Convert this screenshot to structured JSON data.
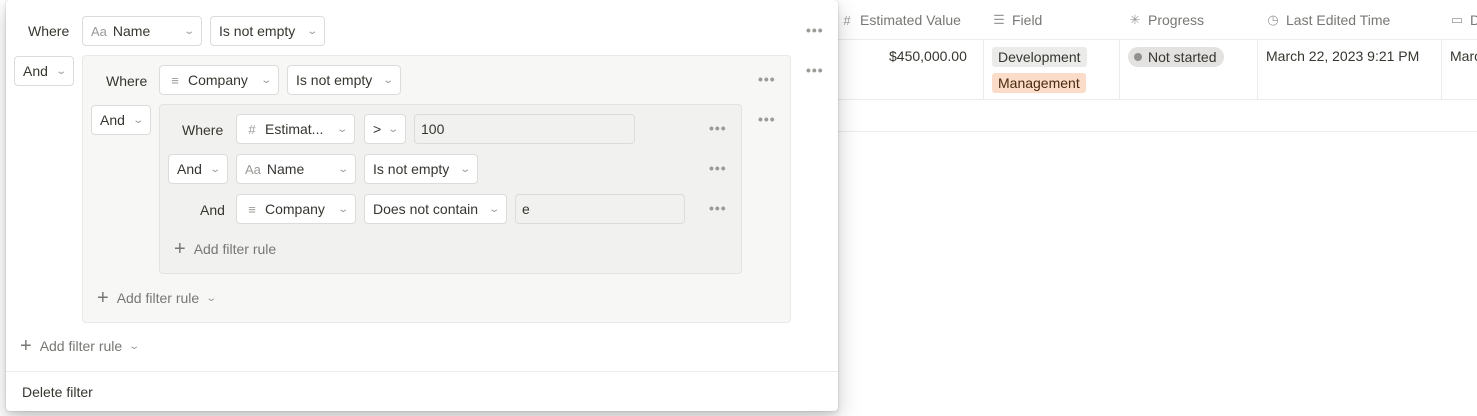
{
  "table": {
    "columns": [
      {
        "icon": "#",
        "icon_name": "number-icon",
        "label": "Estimated Value"
      },
      {
        "icon": "☰",
        "icon_name": "multi-select-icon",
        "label": "Field"
      },
      {
        "icon": "✳",
        "icon_name": "status-icon",
        "label": "Progress"
      },
      {
        "icon": "◷",
        "icon_name": "clock-icon",
        "label": "Last Edited Time"
      },
      {
        "icon": "▭",
        "icon_name": "date-icon",
        "label": "D"
      }
    ],
    "row": {
      "estimated_value": "$450,000.00",
      "field_tags": [
        "Development",
        "Management"
      ],
      "progress": "Not started",
      "last_edited": "March 22, 2023 9:21 PM",
      "date_partial": "Marc"
    }
  },
  "filter": {
    "rule1": {
      "conjunction": "Where",
      "property": "Name",
      "property_icon": "Aa",
      "operator": "Is not empty"
    },
    "group_conjunction": "And",
    "group": {
      "rule1": {
        "conjunction": "Where",
        "property": "Company",
        "property_icon": "≡",
        "operator": "Is not empty"
      },
      "subgroup_conjunction": "And",
      "subgroup": {
        "rule1": {
          "conjunction": "Where",
          "property": "Estimat...",
          "property_icon": "#",
          "operator": ">",
          "value": "100"
        },
        "rule2": {
          "conjunction": "And",
          "property": "Name",
          "property_icon": "Aa",
          "operator": "Is not empty"
        },
        "rule3": {
          "conjunction": "And",
          "property": "Company",
          "property_icon": "≡",
          "operator": "Does not contain",
          "value": "e"
        },
        "add_rule_label": "Add filter rule"
      },
      "add_rule_label": "Add filter rule"
    },
    "add_rule_label": "Add filter rule",
    "delete_label": "Delete filter",
    "more_glyph": "•••",
    "chevron_glyph": "⌄",
    "plus_glyph": "+"
  }
}
